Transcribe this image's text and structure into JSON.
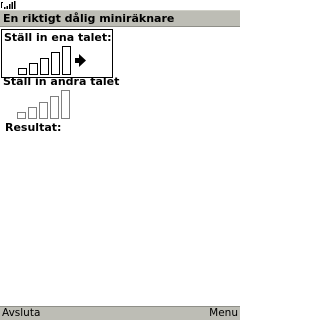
{
  "status": {
    "signal_icon": "signal-strength-icon"
  },
  "app": {
    "title": "En riktigt dålig miniräknare"
  },
  "field1": {
    "label": "Ställ in ena talet:",
    "level": 5,
    "max": 5,
    "focused": true,
    "arrow_icon": "right-arrow-icon"
  },
  "field2": {
    "label": "Ställ in andra talet",
    "level": 0,
    "max": 5,
    "focused": false
  },
  "result": {
    "label": "Resultat:"
  },
  "softkeys": {
    "left": "Avsluta",
    "right": "Menu"
  },
  "colors": {
    "bar_bg": "#bdbdb5",
    "text": "#000000"
  }
}
